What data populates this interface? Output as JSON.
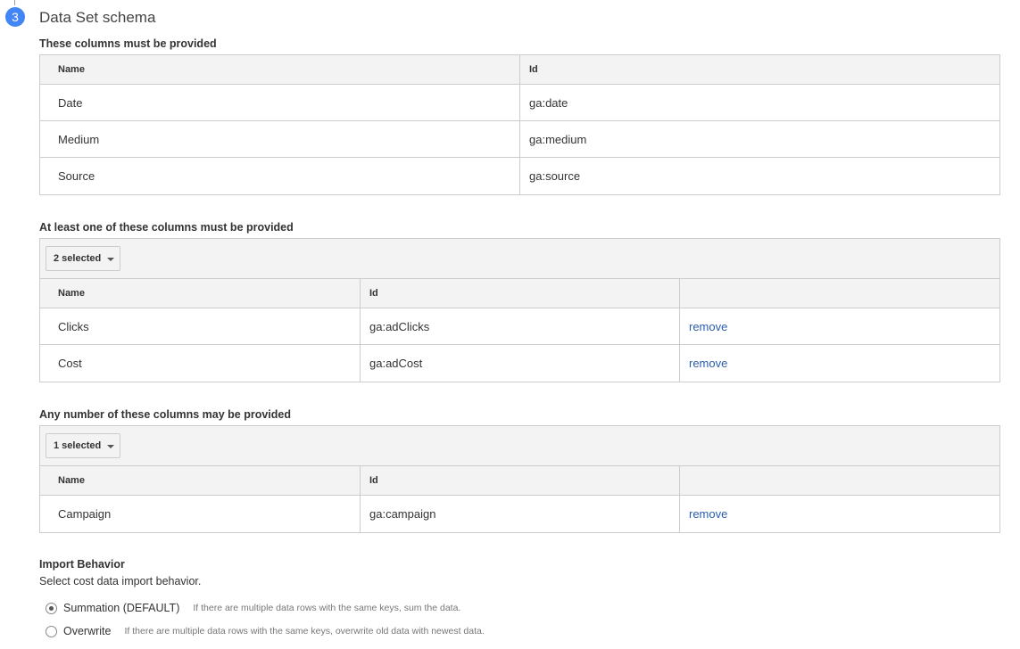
{
  "step": {
    "number": "3",
    "title": "Data Set schema"
  },
  "required": {
    "label": "These columns must be provided",
    "headers": {
      "name": "Name",
      "id": "Id"
    },
    "rows": [
      {
        "name": "Date",
        "id": "ga:date"
      },
      {
        "name": "Medium",
        "id": "ga:medium"
      },
      {
        "name": "Source",
        "id": "ga:source"
      }
    ]
  },
  "at_least_one": {
    "label": "At least one of these columns must be provided",
    "selector": "2 selected",
    "headers": {
      "name": "Name",
      "id": "Id"
    },
    "rows": [
      {
        "name": "Clicks",
        "id": "ga:adClicks",
        "action": "remove"
      },
      {
        "name": "Cost",
        "id": "ga:adCost",
        "action": "remove"
      }
    ]
  },
  "any_number": {
    "label": "Any number of these columns may be provided",
    "selector": "1 selected",
    "headers": {
      "name": "Name",
      "id": "Id"
    },
    "rows": [
      {
        "name": "Campaign",
        "id": "ga:campaign",
        "action": "remove"
      }
    ]
  },
  "import_behavior": {
    "title": "Import Behavior",
    "subtitle": "Select cost data import behavior.",
    "options": [
      {
        "label": "Summation (DEFAULT)",
        "help": "If there are multiple data rows with the same keys, sum the data.",
        "checked": true
      },
      {
        "label": "Overwrite",
        "help": "If there are multiple data rows with the same keys, overwrite old data with newest data.",
        "checked": false
      }
    ]
  },
  "colors": {
    "step_badge": "#4285f4",
    "link": "#2a5db0",
    "border": "#cccccc",
    "header_bg": "#f3f3f3"
  }
}
